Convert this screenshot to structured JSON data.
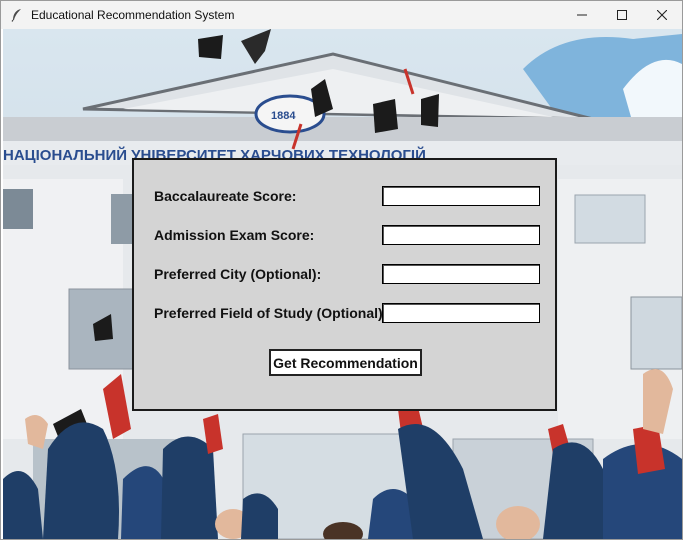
{
  "window": {
    "title": "Educational Recommendation System",
    "controls": [
      "minimize-icon",
      "maximize-icon",
      "close-icon"
    ]
  },
  "form": {
    "fields": [
      {
        "label": "Baccalaureate Score:",
        "value": ""
      },
      {
        "label": "Admission Exam Score:",
        "value": ""
      },
      {
        "label": "Preferred City (Optional):",
        "value": ""
      },
      {
        "label": "Preferred Field of Study (Optional):",
        "value": ""
      }
    ],
    "submit_label": "Get Recommendation"
  },
  "background": {
    "building_sign": "НАЦІОНАЛЬНИЙ УНІВЕРСИТЕТ ХАРЧОВИХ ТЕХНОЛОГІЙ",
    "emblem_text": "1884"
  },
  "colors": {
    "panel": "#d4d4d4",
    "titlebar": "#f3f3f3",
    "sky": "#7fb4dc",
    "building": "#e9ecef",
    "gown": "#1f3e67",
    "accent_red": "#c8332b"
  }
}
